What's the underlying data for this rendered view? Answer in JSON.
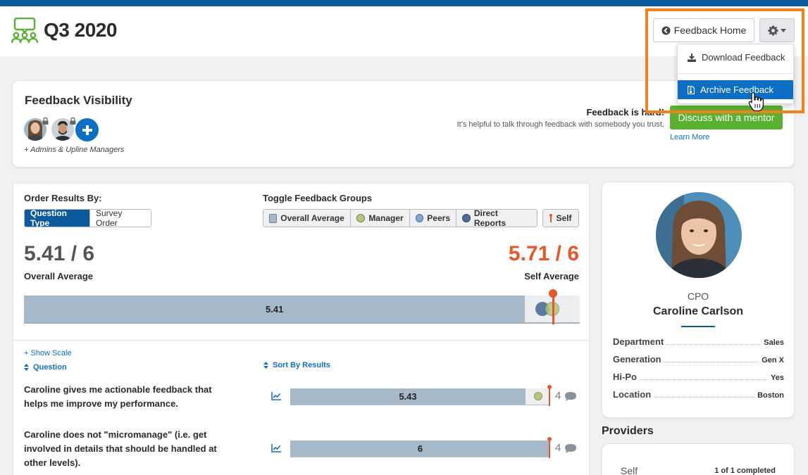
{
  "header": {
    "title": "Q3 2020",
    "feedback_home_label": "Feedback Home",
    "accent_color": "#0c5a9e",
    "logo_color": "#5ab031"
  },
  "settings_menu": {
    "download_label": "Download Feedback",
    "archive_label": "Archive Feedback",
    "highlighted": "Archive Feedback"
  },
  "visibility": {
    "title": "Feedback Visibility",
    "note": "+ Admins & Upline Managers",
    "hard_title": "Feedback is hard!",
    "hard_subtitle": "It's helpful to talk through feedback with somebody you trust.",
    "mentor_button": "Discuss with a mentor",
    "learn_more": "Learn More"
  },
  "results": {
    "order_label": "Order Results By:",
    "order_options": [
      "Question Type",
      "Survey Order"
    ],
    "order_active": "Question Type",
    "toggle_label": "Toggle Feedback Groups",
    "groups": [
      {
        "label": "Overall Average",
        "color": "#a5b9c9"
      },
      {
        "label": "Manager",
        "color": "#b5c77d"
      },
      {
        "label": "Peers",
        "color": "#7fa8d6"
      },
      {
        "label": "Direct Reports",
        "color": "#4e6d98"
      }
    ],
    "self_label": "Self",
    "overall_score": "5.41 / 6",
    "overall_label": "Overall Average",
    "self_score": "5.71 / 6",
    "self_label_full": "Self Average",
    "self_color": "#e8562a",
    "max": 6,
    "overall_value": 5.41,
    "overall_value_label": "5.41",
    "self_value": 5.71,
    "manager_value": 5.7,
    "direct_reports_value": 5.6,
    "show_scale": "+ Show Scale",
    "question_sort": "Question",
    "sort_by_results": "Sort By Results",
    "questions": [
      {
        "text": "Caroline gives me actionable feedback that helps me improve my performance.",
        "value": 5.43,
        "value_label": "5.43",
        "self_value": 6,
        "manager_value": 5.75,
        "count": "4"
      },
      {
        "text": "Caroline does not \"micromanage\" (i.e. get involved in details that should be handled at other levels).",
        "value": 6,
        "value_label": "6",
        "self_value": 6,
        "count": "4"
      }
    ]
  },
  "profile": {
    "role": "CPO",
    "name": "Caroline Carlson",
    "attributes": [
      {
        "key": "Department",
        "value": "Sales"
      },
      {
        "key": "Generation",
        "value": "Gen X"
      },
      {
        "key": "Hi-Po",
        "value": "Yes"
      },
      {
        "key": "Location",
        "value": "Boston"
      }
    ]
  },
  "providers": {
    "title": "Providers",
    "items": [
      {
        "name": "Self",
        "status": "1 of 1 completed"
      }
    ]
  }
}
